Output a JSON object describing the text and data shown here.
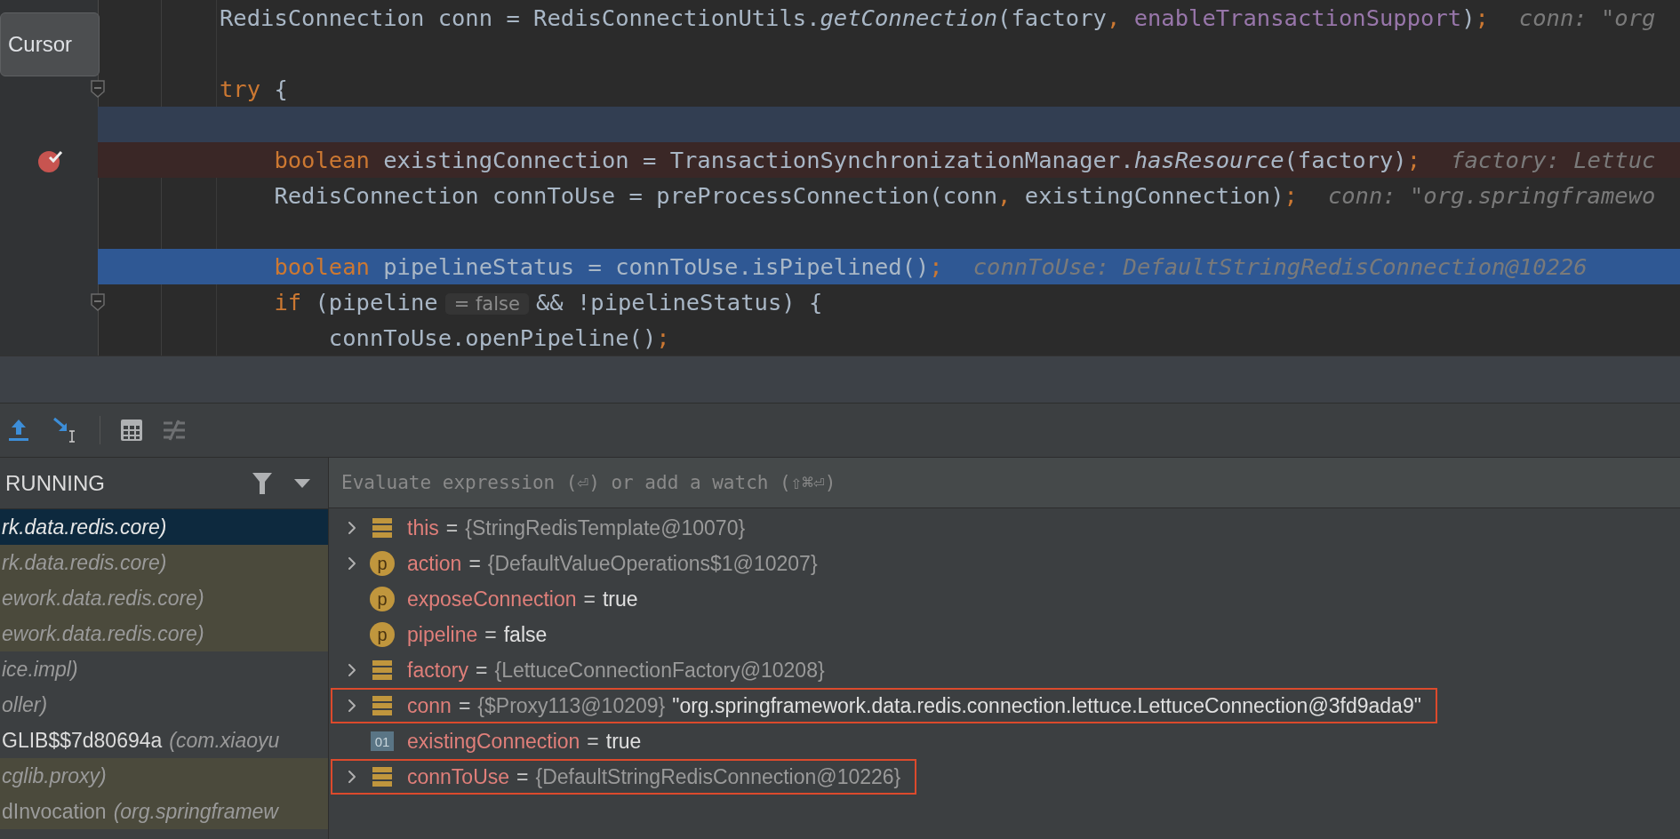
{
  "editor": {
    "tooltip": "Cursor",
    "lines": [
      {
        "caret_line": false,
        "execution_point": false,
        "breakpoint": false,
        "fold": false,
        "tokens": [
          {
            "kind": "plain",
            "text": "RedisConnection conn = RedisConnectionUtils."
          },
          {
            "kind": "method",
            "text": "getConnection"
          },
          {
            "kind": "plain",
            "text": "(factory"
          },
          {
            "kind": "punct",
            "text": ", "
          },
          {
            "kind": "field",
            "text": "enableTransactionSupport"
          },
          {
            "kind": "plain",
            "text": ")"
          },
          {
            "kind": "punct",
            "text": ";"
          }
        ],
        "hint": "conn: \"org"
      },
      {
        "caret_line": false,
        "execution_point": false,
        "breakpoint": false,
        "fold": false
      },
      {
        "caret_line": false,
        "execution_point": false,
        "breakpoint": false,
        "fold": true,
        "tokens": [
          {
            "kind": "keyword",
            "text": "try"
          },
          {
            "kind": "plain",
            "text": " {"
          }
        ]
      },
      {
        "caret_line": true,
        "execution_point": false,
        "breakpoint": false,
        "fold": false
      },
      {
        "caret_line": false,
        "execution_point": false,
        "breakpoint": true,
        "fold": false,
        "tokens": [
          {
            "kind": "keyword",
            "text": "    boolean"
          },
          {
            "kind": "plain",
            "text": " existingConnection = TransactionSynchronizationManager."
          },
          {
            "kind": "method",
            "text": "hasResource"
          },
          {
            "kind": "plain",
            "text": "(factory)"
          },
          {
            "kind": "punct",
            "text": ";"
          }
        ],
        "hint": "factory: Lettuc"
      },
      {
        "caret_line": false,
        "execution_point": false,
        "breakpoint": false,
        "fold": false,
        "tokens": [
          {
            "kind": "plain",
            "text": "    RedisConnection connToUse = preProcessConnection(conn"
          },
          {
            "kind": "punct",
            "text": ", "
          },
          {
            "kind": "plain",
            "text": "existingConnection)"
          },
          {
            "kind": "punct",
            "text": ";"
          }
        ],
        "hint": "conn: \"org.springframewo"
      },
      {
        "caret_line": false,
        "execution_point": false,
        "breakpoint": false,
        "fold": false
      },
      {
        "caret_line": false,
        "execution_point": true,
        "breakpoint": false,
        "fold": false,
        "tokens": [
          {
            "kind": "keyword",
            "text": "    boolean"
          },
          {
            "kind": "plain",
            "text": " pipelineStatus = connToUse.isPipelined()"
          },
          {
            "kind": "punct",
            "text": ";"
          }
        ],
        "hint": "connToUse: DefaultStringRedisConnection@10226"
      },
      {
        "caret_line": false,
        "execution_point": false,
        "breakpoint": false,
        "fold": true,
        "tokens": [
          {
            "kind": "keyword",
            "text": "    if"
          },
          {
            "kind": "plain",
            "text": " (pipeline"
          },
          {
            "kind": "inlay",
            "text": "= false"
          },
          {
            "kind": "plain",
            "text": "&& !pipelineStatus) {"
          }
        ]
      },
      {
        "caret_line": false,
        "execution_point": false,
        "breakpoint": false,
        "fold": false,
        "tokens": [
          {
            "kind": "plain",
            "text": "        connToUse.openPipeline()"
          },
          {
            "kind": "punct",
            "text": ";"
          }
        ]
      }
    ]
  },
  "debugger": {
    "status": "RUNNING",
    "evaluate_placeholder": "Evaluate expression (⏎) or add a watch (⇧⌘⏎)",
    "frames": [
      {
        "package": "rk.data.redis.core)",
        "selected": true,
        "library": false
      },
      {
        "package": "rk.data.redis.core)",
        "selected": false,
        "library": true
      },
      {
        "package": "ework.data.redis.core)",
        "selected": false,
        "library": true
      },
      {
        "package": "ework.data.redis.core)",
        "selected": false,
        "library": true
      },
      {
        "package": "ice.impl)",
        "selected": false,
        "library": false
      },
      {
        "package": "oller)",
        "selected": false,
        "library": false
      },
      {
        "name": "GLIB$$7d80694a",
        "package": "(com.xiaoyu",
        "selected": false,
        "library": false
      },
      {
        "package": "cglib.proxy)",
        "selected": false,
        "library": true
      },
      {
        "name": "dInvocation",
        "package": "(org.springframew",
        "selected": false,
        "library": true
      }
    ],
    "variables": [
      {
        "kind": "field",
        "name": "this",
        "operator": "=",
        "value": "{StringRedisTemplate@10070}",
        "object_value": true,
        "expandable": true,
        "highlighted": false
      },
      {
        "kind": "param",
        "badge": "p",
        "name": "action",
        "operator": "=",
        "value": "{DefaultValueOperations$1@10207}",
        "object_value": true,
        "expandable": true,
        "highlighted": false
      },
      {
        "kind": "param",
        "badge": "p",
        "name": "exposeConnection",
        "operator": "=",
        "value": "true",
        "object_value": false,
        "expandable": false,
        "highlighted": false
      },
      {
        "kind": "param",
        "badge": "p",
        "name": "pipeline",
        "operator": "=",
        "value": "false",
        "object_value": false,
        "expandable": false,
        "highlighted": false
      },
      {
        "kind": "field",
        "name": "factory",
        "operator": "=",
        "value": "{LettuceConnectionFactory@10208}",
        "object_value": true,
        "expandable": true,
        "highlighted": false
      },
      {
        "kind": "field",
        "name": "conn",
        "operator": "=",
        "value": "{$Proxy113@10209}",
        "string": "\"org.springframework.data.redis.connection.lettuce.LettuceConnection@3fd9ada9\"",
        "object_value": true,
        "expandable": true,
        "highlighted": true
      },
      {
        "kind": "primitive",
        "badge": "01",
        "name": "existingConnection",
        "operator": "=",
        "value": "true",
        "object_value": false,
        "expandable": false,
        "highlighted": false
      },
      {
        "kind": "field",
        "name": "connToUse",
        "operator": "=",
        "value": "{DefaultStringRedisConnection@10226}",
        "object_value": true,
        "expandable": true,
        "highlighted": true
      }
    ]
  }
}
